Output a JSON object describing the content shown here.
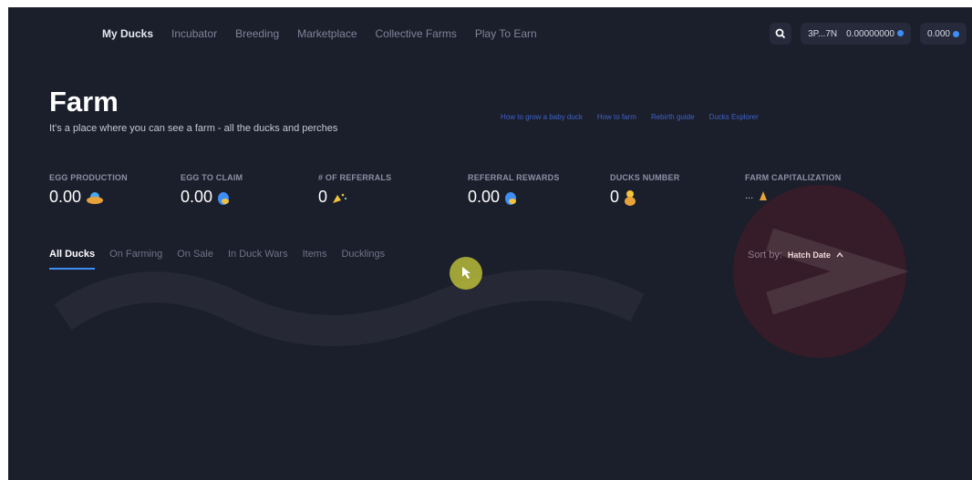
{
  "nav": {
    "items": [
      {
        "label": "My Ducks",
        "active": true
      },
      {
        "label": "Incubator",
        "active": false
      },
      {
        "label": "Breeding",
        "active": false
      },
      {
        "label": "Marketplace",
        "active": false
      },
      {
        "label": "Collective Farms",
        "active": false
      },
      {
        "label": "Play To Earn",
        "active": false
      }
    ],
    "search_icon": "search-icon",
    "wallet": {
      "address": "3P...7N",
      "balance": "0.00000000"
    },
    "balance2": "0.000"
  },
  "header": {
    "title": "Farm",
    "subtitle": "It's a place where you can see a farm - all the ducks and perches",
    "guides": [
      "How to grow a baby duck",
      "How to farm",
      "Rebirth guide",
      "Ducks Explorer"
    ]
  },
  "stats": [
    {
      "label": "EGG PRODUCTION",
      "value": "0.00",
      "icon": "egg-nest-icon"
    },
    {
      "label": "EGG TO CLAIM",
      "value": "0.00",
      "icon": "egg-icon"
    },
    {
      "label": "# OF REFERRALS",
      "value": "0",
      "icon": "party-popper-icon"
    },
    {
      "label": "REFERRAL REWARDS",
      "value": "0.00",
      "icon": "egg-icon"
    },
    {
      "label": "DUCKS NUMBER",
      "value": "0",
      "icon": "duck-icon"
    },
    {
      "label": "FARM CAPITALIZATION",
      "value": "...",
      "icon": "money-bag-icon"
    }
  ],
  "tabs": [
    "All Ducks",
    "On Farming",
    "On Sale",
    "In Duck Wars",
    "Items",
    "Ducklings"
  ],
  "sort": {
    "label": "Sort by:",
    "value": "Hatch Date"
  },
  "colors": {
    "accent": "#3f8ef5",
    "background": "#1b1e2b",
    "link": "#3d63c8"
  }
}
